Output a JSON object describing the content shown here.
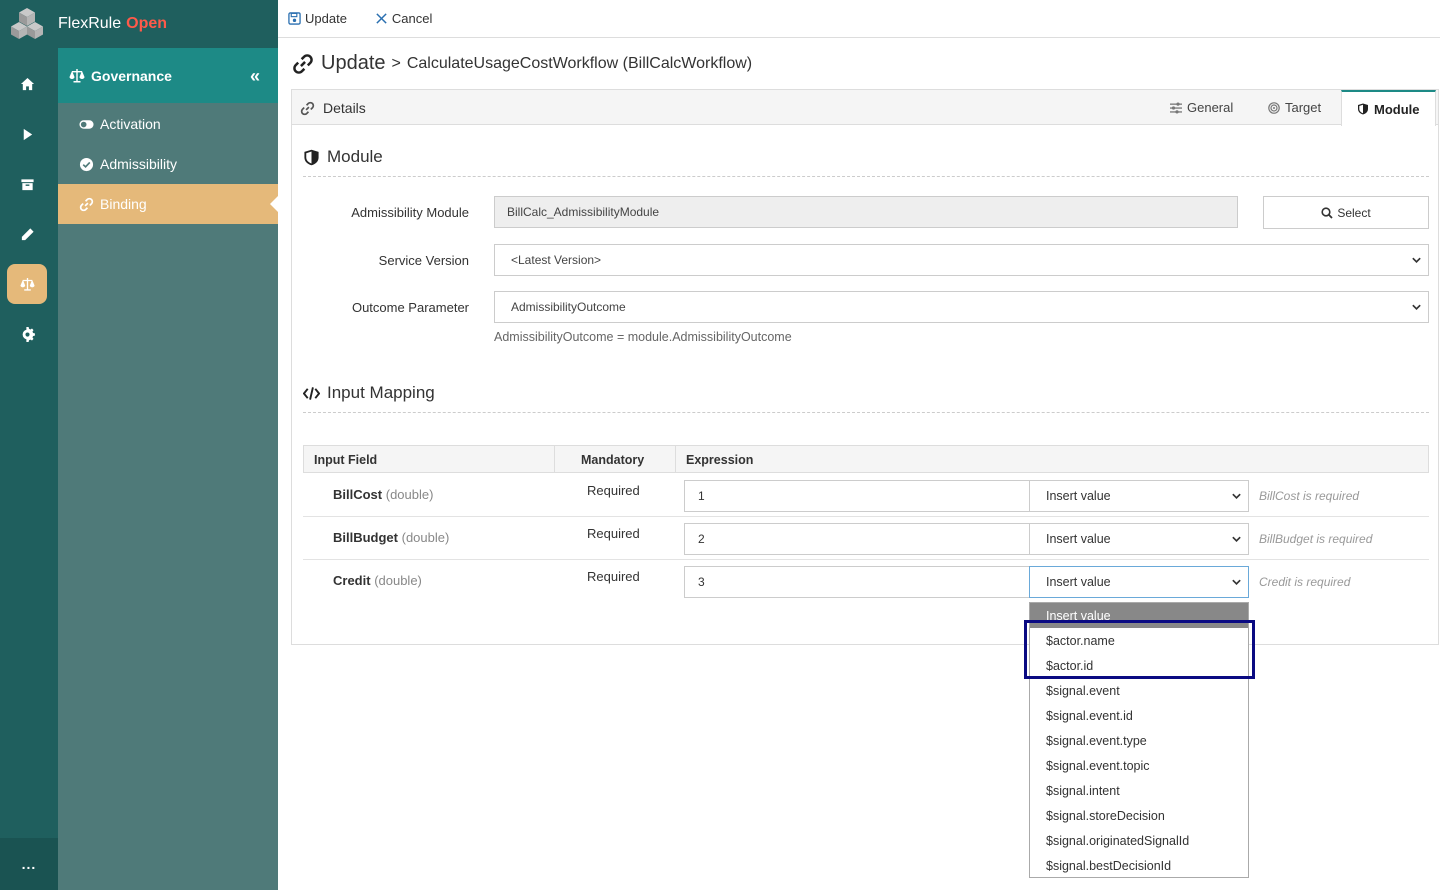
{
  "brand": {
    "name": "FlexRule",
    "suffix": "Open"
  },
  "rail": {
    "icons": [
      "home-icon",
      "play-icon",
      "archive-icon",
      "pencil-icon",
      "scale-icon",
      "gear-icon"
    ],
    "active": "scale-icon",
    "more_label": "..."
  },
  "subnav": {
    "title": "Governance",
    "collapse_label": "«",
    "items": [
      {
        "label": "Activation",
        "icon": "toggle-icon"
      },
      {
        "label": "Admissibility",
        "icon": "check-circle-icon"
      },
      {
        "label": "Binding",
        "icon": "link-icon",
        "active": true
      }
    ]
  },
  "toolbar": {
    "update_label": "Update",
    "cancel_label": "Cancel"
  },
  "page_title": {
    "action": "Update",
    "separator": ">",
    "name": "CalculateUsageCostWorkflow (BillCalcWorkflow)"
  },
  "panel": {
    "title": "Details",
    "tabs": [
      {
        "label": "General",
        "icon": "sliders-icon"
      },
      {
        "label": "Target",
        "icon": "target-icon"
      },
      {
        "label": "Module",
        "icon": "shield-icon",
        "active": true
      }
    ]
  },
  "module": {
    "section_title": "Module",
    "admissibility_label": "Admissibility Module",
    "admissibility_value": "BillCalc_AdmissibilityModule",
    "select_label": "Select",
    "service_version_label": "Service Version",
    "service_version_value": "<Latest Version>",
    "outcome_label": "Outcome Parameter",
    "outcome_value": "AdmissibilityOutcome",
    "outcome_hint": "AdmissibilityOutcome = module.AdmissibilityOutcome"
  },
  "mapping": {
    "section_title": "Input Mapping",
    "columns": [
      "Input Field",
      "Mandatory",
      "Expression"
    ],
    "rows": [
      {
        "field": "BillCost",
        "type": "(double)",
        "mandatory": "Required",
        "expression": "1",
        "insert": "Insert value",
        "message": "BillCost is required"
      },
      {
        "field": "BillBudget",
        "type": "(double)",
        "mandatory": "Required",
        "expression": "2",
        "insert": "Insert value",
        "message": "BillBudget is required"
      },
      {
        "field": "Credit",
        "type": "(double)",
        "mandatory": "Required",
        "expression": "3",
        "insert": "Insert value",
        "message": "Credit is required"
      }
    ]
  },
  "dropdown": {
    "options": [
      "Insert value",
      "$actor.name",
      "$actor.id",
      "$signal.event",
      "$signal.event.id",
      "$signal.event.type",
      "$signal.event.topic",
      "$signal.intent",
      "$signal.storeDecision",
      "$signal.originatedSignalId",
      "$signal.bestDecisionId"
    ],
    "selected_index": 0,
    "highlight_color": "#0a0a82"
  },
  "colors": {
    "rail": "#1f5f5e",
    "subnav_head": "#1d8a86",
    "subnav": "#4f7a79",
    "accent": "#e5b97a",
    "brand_open": "#ff5a4a"
  }
}
